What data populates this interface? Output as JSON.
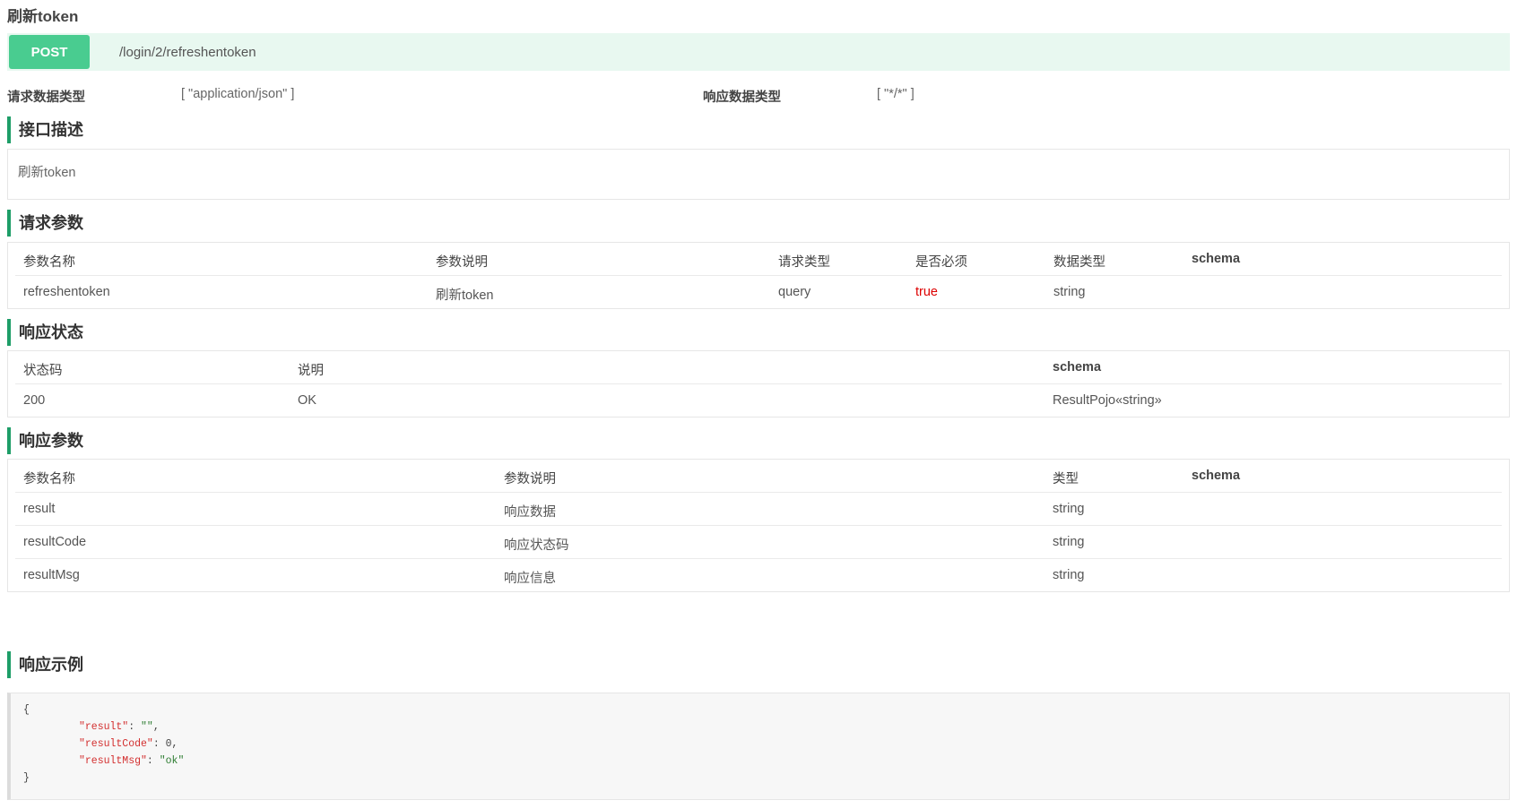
{
  "title": "刷新token",
  "endpoint": {
    "method": "POST",
    "path": "/login/2/refreshentoken"
  },
  "mime": {
    "request_label": "请求数据类型",
    "request_value": "[ \"application/json\" ]",
    "response_label": "响应数据类型",
    "response_value": "[ \"*/*\" ]"
  },
  "sections": {
    "description": {
      "title": "接口描述",
      "text": "刷新token"
    },
    "request_params": {
      "title": "请求参数",
      "headers": [
        "参数名称",
        "参数说明",
        "请求类型",
        "是否必须",
        "数据类型",
        "schema"
      ],
      "rows": [
        [
          "refreshentoken",
          "刷新token",
          "query",
          "true",
          "string",
          ""
        ]
      ]
    },
    "response_status": {
      "title": "响应状态",
      "headers": [
        "状态码",
        "说明",
        "schema"
      ],
      "rows": [
        [
          "200",
          "OK",
          "ResultPojo«string»"
        ]
      ]
    },
    "response_params": {
      "title": "响应参数",
      "headers": [
        "参数名称",
        "参数说明",
        "类型",
        "schema"
      ],
      "rows": [
        [
          "result",
          "响应数据",
          "string",
          ""
        ],
        [
          "resultCode",
          "响应状态码",
          "string",
          ""
        ],
        [
          "resultMsg",
          "响应信息",
          "string",
          ""
        ]
      ]
    },
    "response_example": {
      "title": "响应示例",
      "open_brace": "{",
      "close_brace": "}",
      "lines": [
        {
          "key": "\"result\"",
          "sep": ": ",
          "value": "\"\"",
          "trail": ",",
          "value_is_string": true
        },
        {
          "key": "\"resultCode\"",
          "sep": ": ",
          "value": "0",
          "trail": ",",
          "value_is_string": false
        },
        {
          "key": "\"resultMsg\"",
          "sep": ": ",
          "value": "\"ok\"",
          "trail": "",
          "value_is_string": true
        }
      ]
    }
  },
  "colors": {
    "post_badge": "#49cc90",
    "endpoint_bg": "#e8f8f0",
    "section_accent": "#1e9e68",
    "required_true": "#dd0000"
  }
}
